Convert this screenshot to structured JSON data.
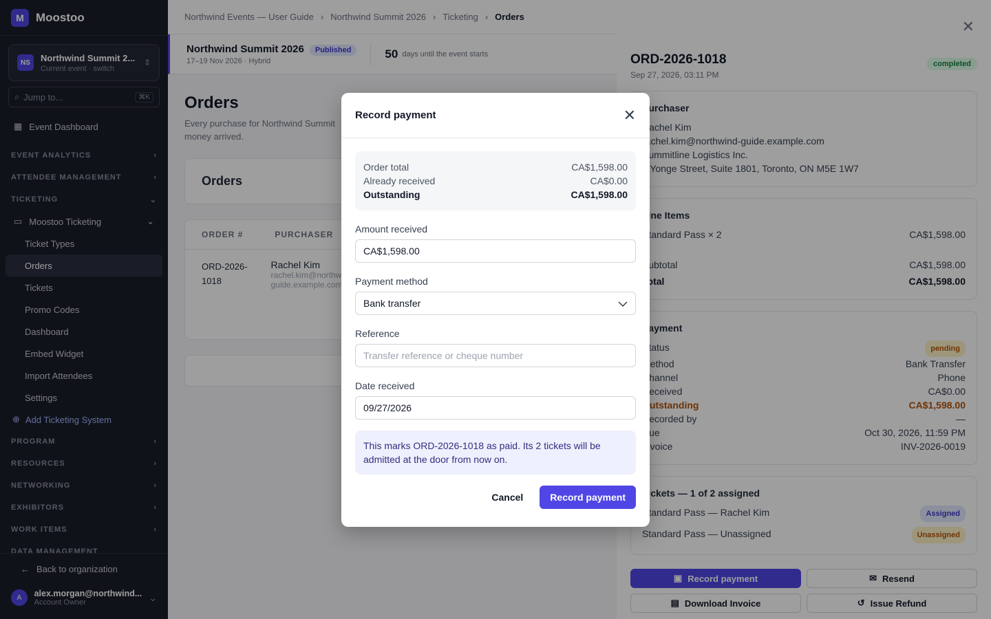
{
  "app": {
    "logo": "M",
    "name": "Moostoo"
  },
  "event_switcher": {
    "avatar": "NS",
    "name": "Northwind Summit 2...",
    "sub": "Current event · switch"
  },
  "jump": {
    "placeholder": "Jump to...",
    "shortcut": "⌘K"
  },
  "sidebar": {
    "dashboard": "Event Dashboard",
    "sections": {
      "event_analytics": "EVENT ANALYTICS",
      "attendee_management": "ATTENDEE MANAGEMENT",
      "ticketing": "TICKETING",
      "program": "PROGRAM",
      "resources": "RESOURCES",
      "networking": "NETWORKING",
      "exhibitors": "EXHIBITORS",
      "work_items": "WORK ITEMS",
      "data_management": "DATA MANAGEMENT"
    },
    "ticketing_system": "Moostoo Ticketing",
    "sub_items": [
      "Ticket Types",
      "Orders",
      "Tickets",
      "Promo Codes",
      "Dashboard",
      "Embed Widget",
      "Import Attendees",
      "Settings"
    ],
    "add_system": "Add Ticketing System",
    "back": "Back to organization",
    "user": {
      "avatar": "A",
      "name": "alex.morgan@northwind...",
      "role": "Account Owner"
    }
  },
  "breadcrumb": [
    "Northwind Events — User Guide",
    "Northwind Summit 2026",
    "Ticketing",
    "Orders"
  ],
  "event_bar": {
    "title": "Northwind Summit 2026",
    "badge": "Published",
    "sub": "17–19 Nov 2026 · Hybrid",
    "days": "50",
    "days_label": "days until the event starts"
  },
  "page": {
    "title": "Orders",
    "desc_1": "Every purchase for Northwind Summit",
    "desc_2": "money arrived.",
    "card_title": "Orders"
  },
  "table": {
    "col_order": "ORDER #",
    "col_purchaser": "PURCHASER",
    "order_1": "ORD-2026-",
    "order_2": "1018",
    "purchaser_name": "Rachel Kim",
    "purchaser_email_1": "rachel.kim@northw",
    "purchaser_email_2": "guide.example.com"
  },
  "drawer": {
    "order_id": "ORD-2026-1018",
    "date": "Sep 27, 2026, 03:11 PM",
    "status": "completed",
    "purchaser": {
      "title": "Purchaser",
      "name": "Rachel Kim",
      "email": "rachel.kim@northwind-guide.example.com",
      "company": "Summitline Logistics Inc.",
      "address": "1 Yonge Street, Suite 1801, Toronto, ON M5E 1W7"
    },
    "line_items": {
      "title": "Line Items",
      "item": "Standard Pass × 2",
      "item_amount": "CA$1,598.00",
      "subtotal_label": "Subtotal",
      "subtotal": "CA$1,598.00",
      "total_label": "Total",
      "total": "CA$1,598.00"
    },
    "payment": {
      "title": "Payment",
      "status_label": "Status",
      "status": "pending",
      "method_label": "Method",
      "method": "Bank Transfer",
      "channel_label": "Channel",
      "channel": "Phone",
      "received_label": "Received",
      "received": "CA$0.00",
      "outstanding_label": "Outstanding",
      "outstanding": "CA$1,598.00",
      "recorded_label": "Recorded by",
      "recorded": "—",
      "due_label": "Due",
      "due": "Oct 30, 2026, 11:59 PM",
      "invoice_label": "Invoice",
      "invoice": "INV-2026-0019"
    },
    "tickets": {
      "title": "Tickets — 1 of 2 assigned",
      "t1": "Standard Pass — Rachel Kim",
      "t1_status": "Assigned",
      "t2": "Standard Pass — Unassigned",
      "t2_status": "Unassigned"
    },
    "actions": {
      "record": "Record payment",
      "resend": "Resend",
      "download": "Download Invoice",
      "refund": "Issue Refund"
    }
  },
  "modal": {
    "title": "Record payment",
    "summary": {
      "order_total_label": "Order total",
      "order_total": "CA$1,598.00",
      "already_label": "Already received",
      "already": "CA$0.00",
      "outstanding_label": "Outstanding",
      "outstanding": "CA$1,598.00"
    },
    "amount_label": "Amount received",
    "amount_value": "CA$1,598.00",
    "method_label": "Payment method",
    "method_value": "Bank transfer",
    "reference_label": "Reference",
    "reference_placeholder": "Transfer reference or cheque number",
    "date_label": "Date received",
    "date_value": "09/27/2026",
    "info": "This marks ORD-2026-1018 as paid. Its 2 tickets will be admitted at the door from now on.",
    "cancel": "Cancel",
    "submit": "Record payment"
  },
  "colors": {
    "accent": "#4f46e5",
    "sidebar_bg": "#1b1d2a",
    "completed": "#15803d",
    "pending": "#b45309"
  }
}
